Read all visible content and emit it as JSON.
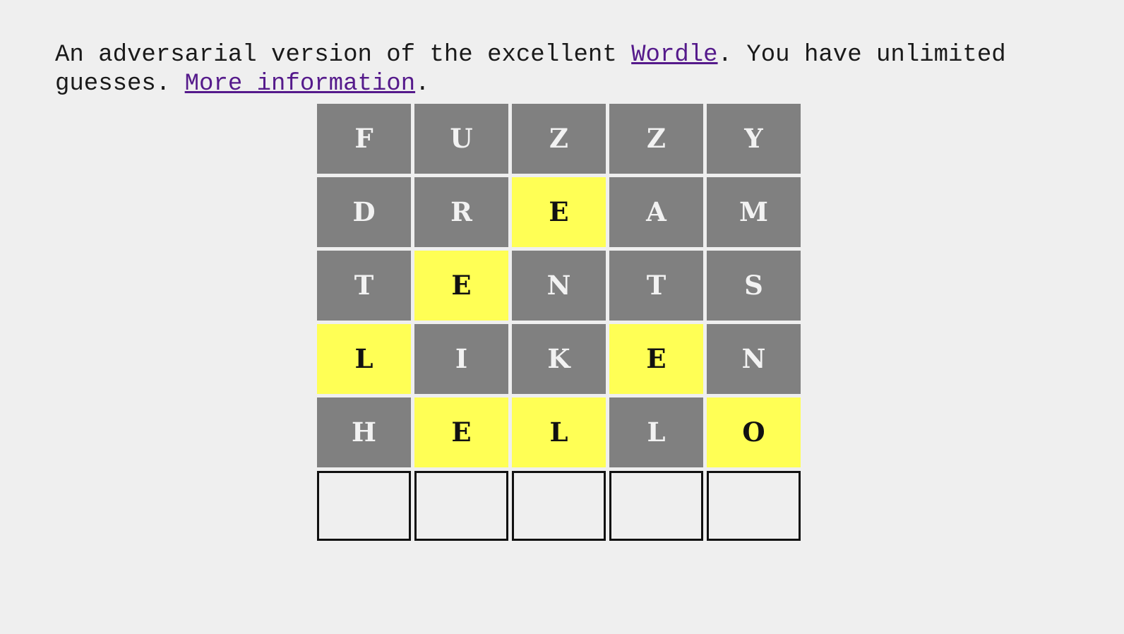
{
  "intro": {
    "part1": "An adversarial version of the excellent ",
    "link_wordle": "Wordle",
    "part2": ". You have unlimited guesses. ",
    "link_more": "More information",
    "part3": "."
  },
  "colors": {
    "background": "#efefef",
    "absent": "#808080",
    "present": "#ffff55",
    "empty_border": "#111111",
    "link": "#551a8b",
    "absent_text": "#f2f2f2",
    "present_text": "#111111"
  },
  "board": {
    "rows": 6,
    "columns": 5,
    "guesses": [
      {
        "word": "FUZZY",
        "tiles": [
          {
            "letter": "F",
            "state": "absent"
          },
          {
            "letter": "U",
            "state": "absent"
          },
          {
            "letter": "Z",
            "state": "absent"
          },
          {
            "letter": "Z",
            "state": "absent"
          },
          {
            "letter": "Y",
            "state": "absent"
          }
        ]
      },
      {
        "word": "DREAM",
        "tiles": [
          {
            "letter": "D",
            "state": "absent"
          },
          {
            "letter": "R",
            "state": "absent"
          },
          {
            "letter": "E",
            "state": "present"
          },
          {
            "letter": "A",
            "state": "absent"
          },
          {
            "letter": "M",
            "state": "absent"
          }
        ]
      },
      {
        "word": "TENTS",
        "tiles": [
          {
            "letter": "T",
            "state": "absent"
          },
          {
            "letter": "E",
            "state": "present"
          },
          {
            "letter": "N",
            "state": "absent"
          },
          {
            "letter": "T",
            "state": "absent"
          },
          {
            "letter": "S",
            "state": "absent"
          }
        ]
      },
      {
        "word": "LIKEN",
        "tiles": [
          {
            "letter": "L",
            "state": "present"
          },
          {
            "letter": "I",
            "state": "absent"
          },
          {
            "letter": "K",
            "state": "absent"
          },
          {
            "letter": "E",
            "state": "present"
          },
          {
            "letter": "N",
            "state": "absent"
          }
        ]
      },
      {
        "word": "HELLO",
        "tiles": [
          {
            "letter": "H",
            "state": "absent"
          },
          {
            "letter": "E",
            "state": "present"
          },
          {
            "letter": "L",
            "state": "present"
          },
          {
            "letter": "L",
            "state": "absent"
          },
          {
            "letter": "O",
            "state": "present"
          }
        ]
      },
      {
        "word": "",
        "tiles": [
          {
            "letter": "",
            "state": "empty"
          },
          {
            "letter": "",
            "state": "empty"
          },
          {
            "letter": "",
            "state": "empty"
          },
          {
            "letter": "",
            "state": "empty"
          },
          {
            "letter": "",
            "state": "empty"
          }
        ]
      }
    ]
  }
}
